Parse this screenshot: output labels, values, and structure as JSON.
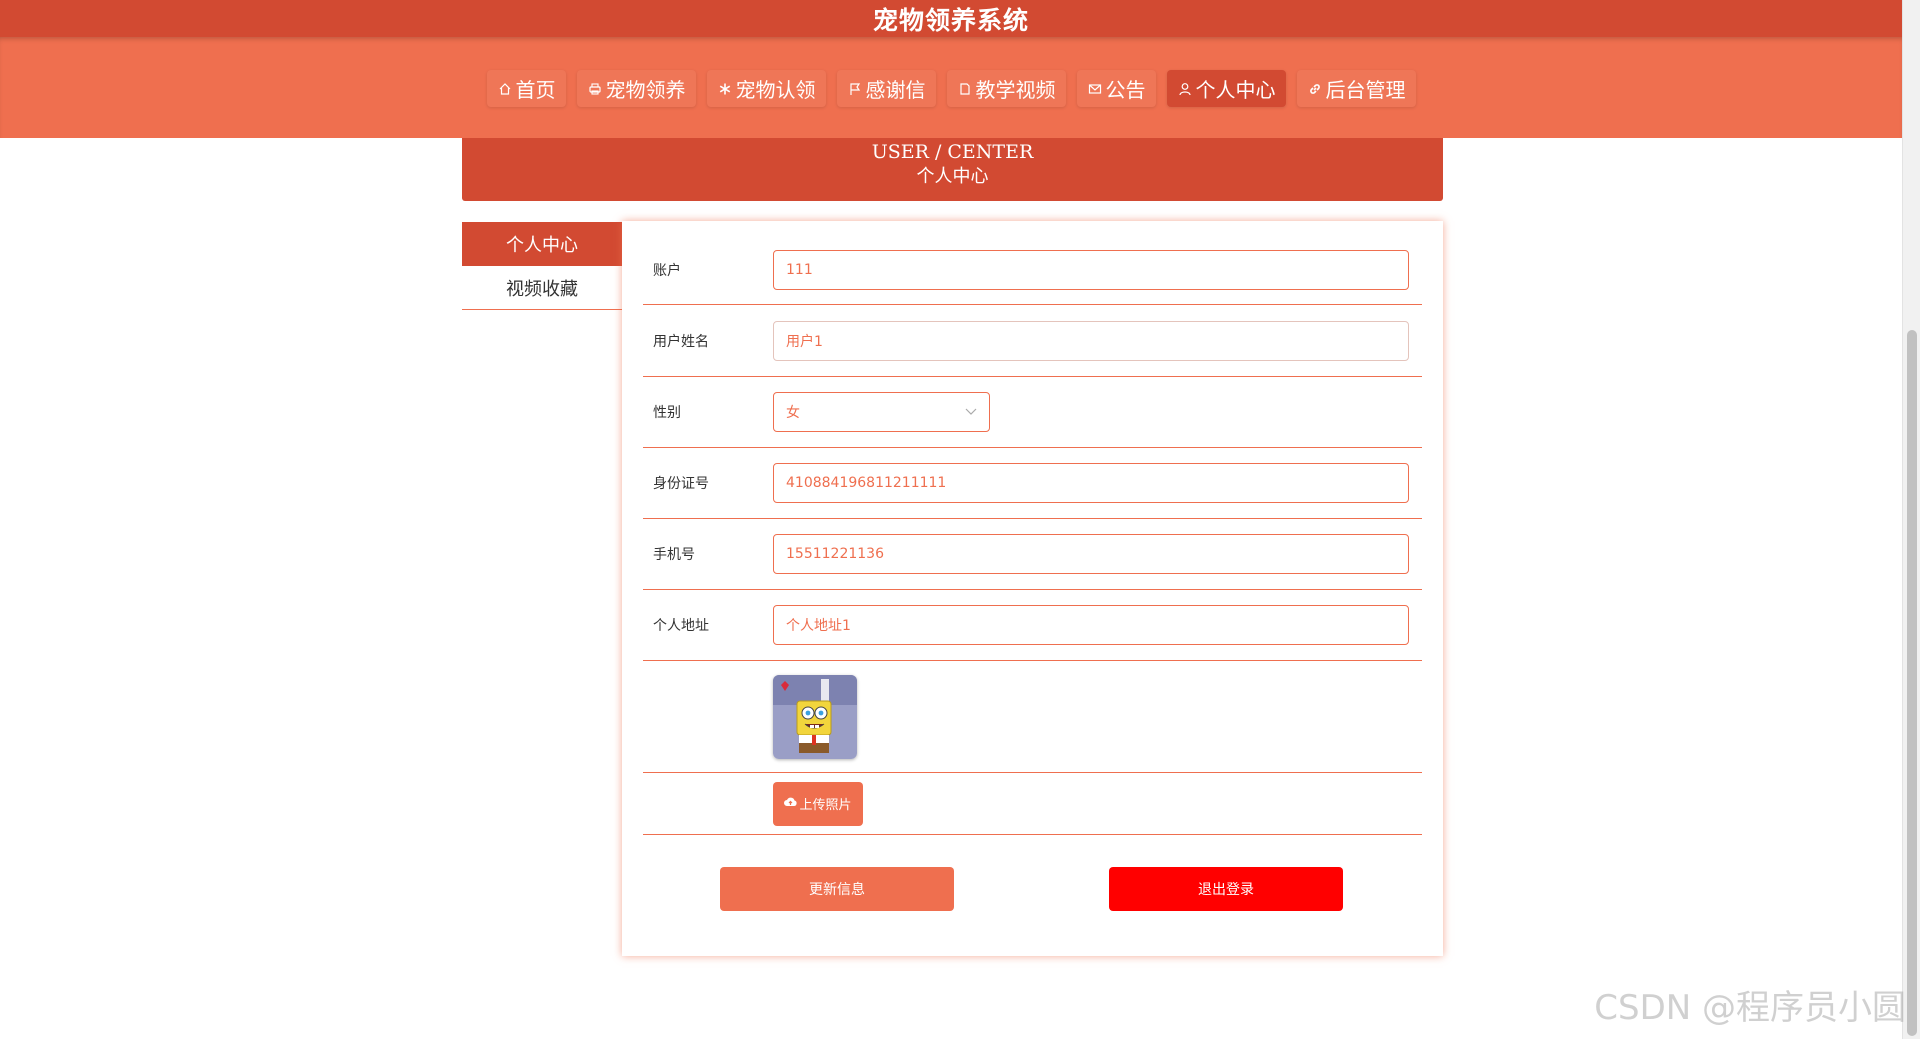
{
  "app": {
    "title": "宠物领养系统"
  },
  "nav": {
    "items": [
      {
        "label": "首页",
        "icon": "home-icon"
      },
      {
        "label": "宠物领养",
        "icon": "printer-icon"
      },
      {
        "label": "宠物认领",
        "icon": "asterisk-icon"
      },
      {
        "label": "感谢信",
        "icon": "flag-icon"
      },
      {
        "label": "教学视频",
        "icon": "document-icon"
      },
      {
        "label": "公告",
        "icon": "mail-icon"
      },
      {
        "label": "个人中心",
        "icon": "user-icon",
        "active": true
      },
      {
        "label": "后台管理",
        "icon": "link-icon"
      }
    ]
  },
  "banner": {
    "en": "USER / CENTER",
    "zh": "个人中心"
  },
  "sidemenu": {
    "items": [
      {
        "label": "个人中心",
        "active": true
      },
      {
        "label": "视频收藏"
      }
    ]
  },
  "form": {
    "account": {
      "label": "账户",
      "value": "111"
    },
    "name": {
      "label": "用户姓名",
      "value": "用户1"
    },
    "gender": {
      "label": "性别",
      "value": "女"
    },
    "id_number": {
      "label": "身份证号",
      "value": "410884196811211111"
    },
    "phone": {
      "label": "手机号",
      "value": "15511221136"
    },
    "address": {
      "label": "个人地址",
      "value": "个人地址1"
    },
    "upload_label": "上传照片",
    "update_label": "更新信息",
    "logout_label": "退出登录"
  },
  "watermark": "CSDN @程序员小圆",
  "colors": {
    "primary": "#d24a32",
    "accent": "#ef6f4f",
    "danger": "#ff0000"
  }
}
